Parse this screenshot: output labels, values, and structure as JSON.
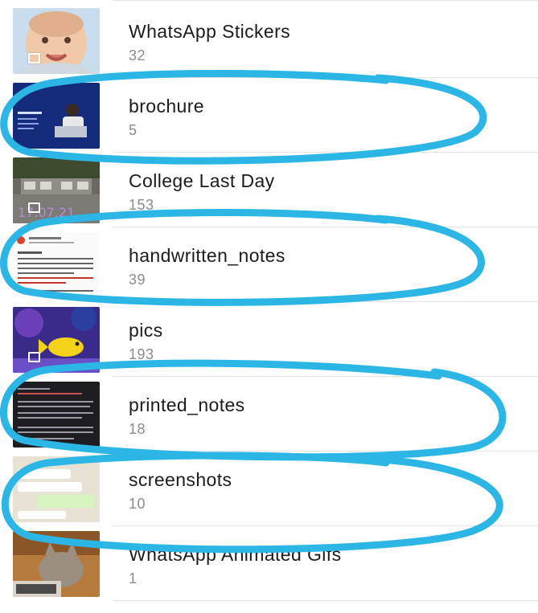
{
  "albums": [
    {
      "name": "WhatsApp Stickers",
      "count": "32",
      "thumb": "baby-photo"
    },
    {
      "name": "brochure",
      "count": "5",
      "thumb": "brochure-page"
    },
    {
      "name": "College Last Day",
      "count": "153",
      "thumb": "college-photo"
    },
    {
      "name": "handwritten_notes",
      "count": "39",
      "thumb": "document-page"
    },
    {
      "name": "pics",
      "count": "193",
      "thumb": "fish-photo"
    },
    {
      "name": "printed_notes",
      "count": "18",
      "thumb": "dark-text-page"
    },
    {
      "name": "screenshots",
      "count": "10",
      "thumb": "chat-screenshot"
    },
    {
      "name": "WhatsApp Animated Gifs",
      "count": "1",
      "thumb": "cat-photo"
    }
  ],
  "colors": {
    "title": "#1c1c1c",
    "count": "#8c8c8c",
    "annotation": "#2bb6e6",
    "divider": "#e3e3e3"
  }
}
